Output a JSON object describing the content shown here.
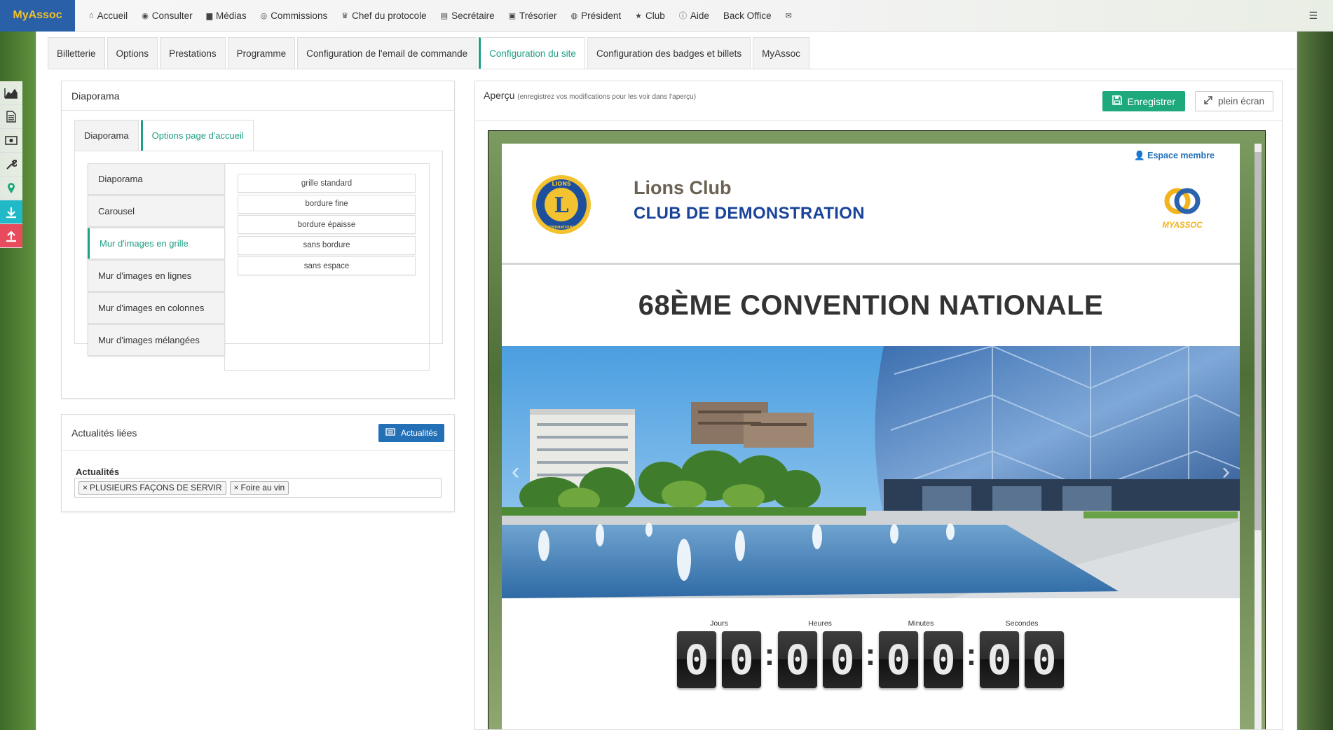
{
  "brand": "MyAssoc",
  "nav": [
    {
      "label": "Accueil",
      "icon": "home-icon",
      "glyph": "⌂"
    },
    {
      "label": "Consulter",
      "icon": "eye-icon",
      "glyph": "◉"
    },
    {
      "label": "Médias",
      "icon": "file-icon",
      "glyph": "▆"
    },
    {
      "label": "Commissions",
      "icon": "user-circle-icon",
      "glyph": "◎"
    },
    {
      "label": "Chef du protocole",
      "icon": "trophy-icon",
      "glyph": "♛"
    },
    {
      "label": "Secrétaire",
      "icon": "book-icon",
      "glyph": "▤"
    },
    {
      "label": "Trésorier",
      "icon": "money-icon",
      "glyph": "▣"
    },
    {
      "label": "Président",
      "icon": "globe-icon",
      "glyph": "◍"
    },
    {
      "label": "Club",
      "icon": "star-icon",
      "glyph": "★"
    },
    {
      "label": "Aide",
      "icon": "info-icon",
      "glyph": "ⓘ"
    },
    {
      "label": "Back Office",
      "icon": "",
      "glyph": ""
    },
    {
      "label": "",
      "icon": "envelope-icon",
      "glyph": "✉"
    }
  ],
  "tabs": [
    {
      "label": "Billetterie",
      "active": false
    },
    {
      "label": "Options",
      "active": false
    },
    {
      "label": "Prestations",
      "active": false
    },
    {
      "label": "Programme",
      "active": false
    },
    {
      "label": "Configuration de l'email de commande",
      "active": false
    },
    {
      "label": "Configuration du site",
      "active": true
    },
    {
      "label": "Configuration des badges et billets",
      "active": false
    },
    {
      "label": "MyAssoc",
      "active": false
    }
  ],
  "diaporama": {
    "title": "Diaporama",
    "subtabs": [
      {
        "label": "Diaporama",
        "active": false
      },
      {
        "label": "Options page d'accueil",
        "active": true
      }
    ],
    "items": [
      {
        "label": "Diaporama",
        "active": false
      },
      {
        "label": "Carousel",
        "active": false
      },
      {
        "label": "Mur d'images en grille",
        "active": true
      },
      {
        "label": "Mur d'images en lignes",
        "active": false
      },
      {
        "label": "Mur d'images en colonnes",
        "active": false
      },
      {
        "label": "Mur d'images mélangées",
        "active": false
      }
    ],
    "options": [
      "grille standard",
      "bordure fine",
      "bordure épaisse",
      "sans bordure",
      "sans espace"
    ]
  },
  "actualites": {
    "title": "Actualités liées",
    "button": "Actualités",
    "field_label": "Actualités",
    "tags": [
      "PLUSIEURS FAÇONS DE SERVIR",
      "Foire au vin"
    ],
    "tag_remove": "×"
  },
  "apercu": {
    "title": "Aperçu",
    "hint": "(enregistrez vos modifications pour les voir dans l'aperçu)",
    "save": "Enregistrer",
    "fullscreen": "plein écran"
  },
  "site": {
    "espace": "Espace membre",
    "club_name": "Lions Club",
    "club_sub": "CLUB DE DEMONSTRATION",
    "lions_logo_text": "LIONS",
    "lions_logo_text2": "INTERNATIONAL",
    "myassoc_logo_text": "MYASSOC",
    "event_title": "68ÈME CONVENTION NATIONALE",
    "arrow_prev": "‹",
    "arrow_next": "›",
    "countdown": [
      {
        "label": "Jours",
        "digits": [
          "0",
          "0"
        ]
      },
      {
        "label": "Heures",
        "digits": [
          "0",
          "0"
        ]
      },
      {
        "label": "Minutes",
        "digits": [
          "0",
          "0"
        ]
      },
      {
        "label": "Secondes",
        "digits": [
          "0",
          "0"
        ]
      }
    ],
    "colon": ":"
  },
  "colors": {
    "accent": "#1e9e84",
    "brand": "#2a60a8",
    "primary_button": "#2470b7",
    "save_button": "#1ea97c"
  }
}
